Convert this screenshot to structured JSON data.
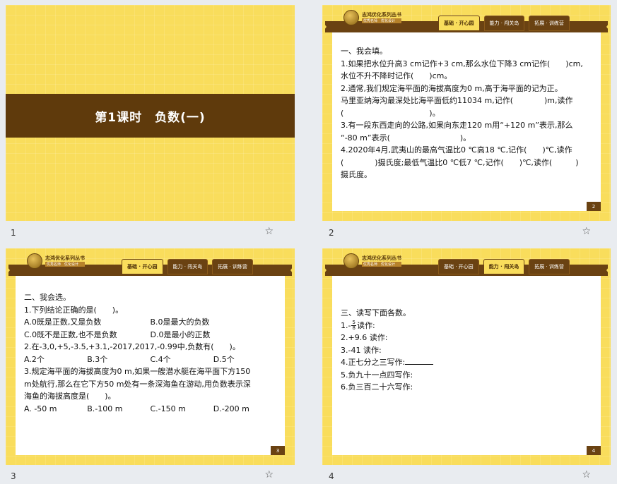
{
  "slides": [
    {
      "number": "1",
      "title": "第1课时　负数(一)"
    },
    {
      "number": "2",
      "page": "2",
      "section": "一、我会填。",
      "lines": [
        "1.如果把水位升高3 cm记作+3 cm,那么水位下降3 cm记作(　　)cm,",
        "水位不升不降时记作(　　)cm。",
        "2.通常,我们规定海平面的海拔高度为0 m,高于海平面的记为正。",
        "马里亚纳海沟最深处比海平面低约11034 m,记作(　　　　)m,读作",
        "(　　　　　　　　　　　)。",
        "3.有一段东西走向的公路,如果向东走120 m用“+120 m”表示,那么",
        "“-80 m”表示(　　　　　　　　　)。",
        "4.2020年4月,武夷山的最高气温比0 ℃高18 ℃,记作(　　)℃,读作",
        "(　　　　)摄氏度;最低气温比0 ℃低7 ℃,记作(　　)℃,读作(　　　)",
        "摄氏度。"
      ]
    },
    {
      "number": "3",
      "page": "3",
      "section": "二、我会选。",
      "q1": "1.下列结论正确的是(　　)。",
      "q1_options": [
        "A.0既是正数,又是负数",
        "B.0是最大的负数",
        "C.0既不是正数,也不是负数",
        "D.0是最小的正数"
      ],
      "q2": "2.在-3,0,+5,-3.5,+3.1,-2017,2017,-0.99中,负数有(　　)。",
      "q2_options": [
        "A.2个",
        "B.3个",
        "C.4个",
        "D.5个"
      ],
      "q3_lines": [
        "3.规定海平面的海拔高度为0 m,如果一艘潜水艇在海平面下方150",
        "m处航行,那么在它下方50 m处有一条深海鱼在游动,用负数表示深",
        "海鱼的海拔高度是(　　)。"
      ],
      "q3_options": [
        "A. -50 m",
        "B.-100 m",
        "C.-150 m",
        "D.-200 m"
      ]
    },
    {
      "number": "4",
      "page": "4",
      "section": "三、读写下面各数。",
      "items": [
        {
          "prefix": "1.",
          "frac_sign": "-",
          "frac_num": "5",
          "frac_den": "8",
          "suffix": "读作:"
        },
        {
          "prefix": "2.",
          "text": "+9.6 读作:"
        },
        {
          "prefix": "3.",
          "text": "-41 读作:"
        },
        {
          "prefix": "4.",
          "text": "正七分之三写作:"
        },
        {
          "prefix": "5.",
          "text": "负九十一点四写作:"
        },
        {
          "prefix": "6.",
          "text": "负三百二十六写作:"
        }
      ]
    }
  ],
  "header": {
    "logo_title": "志鸿优化系列丛书",
    "logo_sub": "优秀名师　优化设计",
    "tabs": [
      "基础 · 开心园",
      "能力 · 闯关岛",
      "拓展 · 训练营"
    ]
  },
  "tab_active": {
    "slide2": 0,
    "slide3": 0,
    "slide4": 1
  },
  "star_icon": "star-outline-icon",
  "colors": {
    "slide_bg": "#f9dd5c",
    "band": "#5f3a0c",
    "chrome": "#6a4212"
  }
}
